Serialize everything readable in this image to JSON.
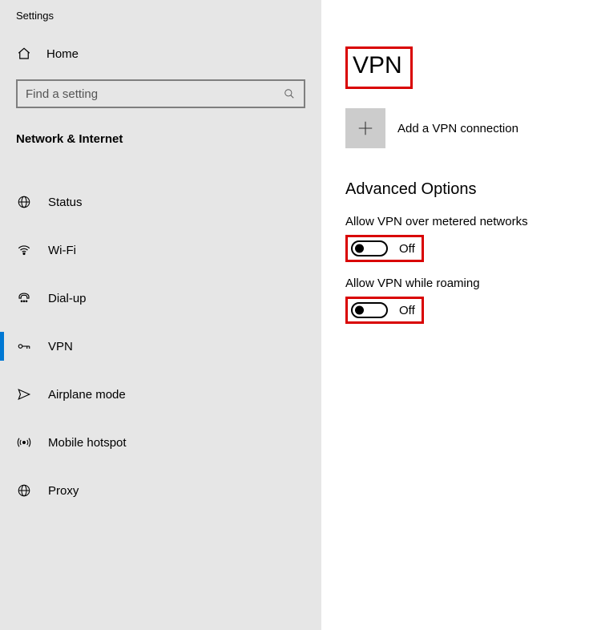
{
  "app": {
    "title": "Settings"
  },
  "home": {
    "label": "Home"
  },
  "search": {
    "placeholder": "Find a setting"
  },
  "sidebar": {
    "section": "Network & Internet",
    "items": [
      {
        "label": "Status",
        "icon": "status-icon",
        "active": false
      },
      {
        "label": "Wi-Fi",
        "icon": "wifi-icon",
        "active": false
      },
      {
        "label": "Dial-up",
        "icon": "dialup-icon",
        "active": false
      },
      {
        "label": "VPN",
        "icon": "vpn-icon",
        "active": true
      },
      {
        "label": "Airplane mode",
        "icon": "airplane-icon",
        "active": false
      },
      {
        "label": "Mobile hotspot",
        "icon": "hotspot-icon",
        "active": false
      },
      {
        "label": "Proxy",
        "icon": "proxy-icon",
        "active": false
      }
    ]
  },
  "main": {
    "title": "VPN",
    "add_label": "Add a VPN connection",
    "advanced_heading": "Advanced Options",
    "settings": [
      {
        "label": "Allow VPN over metered networks",
        "state": "Off"
      },
      {
        "label": "Allow VPN while roaming",
        "state": "Off"
      }
    ]
  }
}
